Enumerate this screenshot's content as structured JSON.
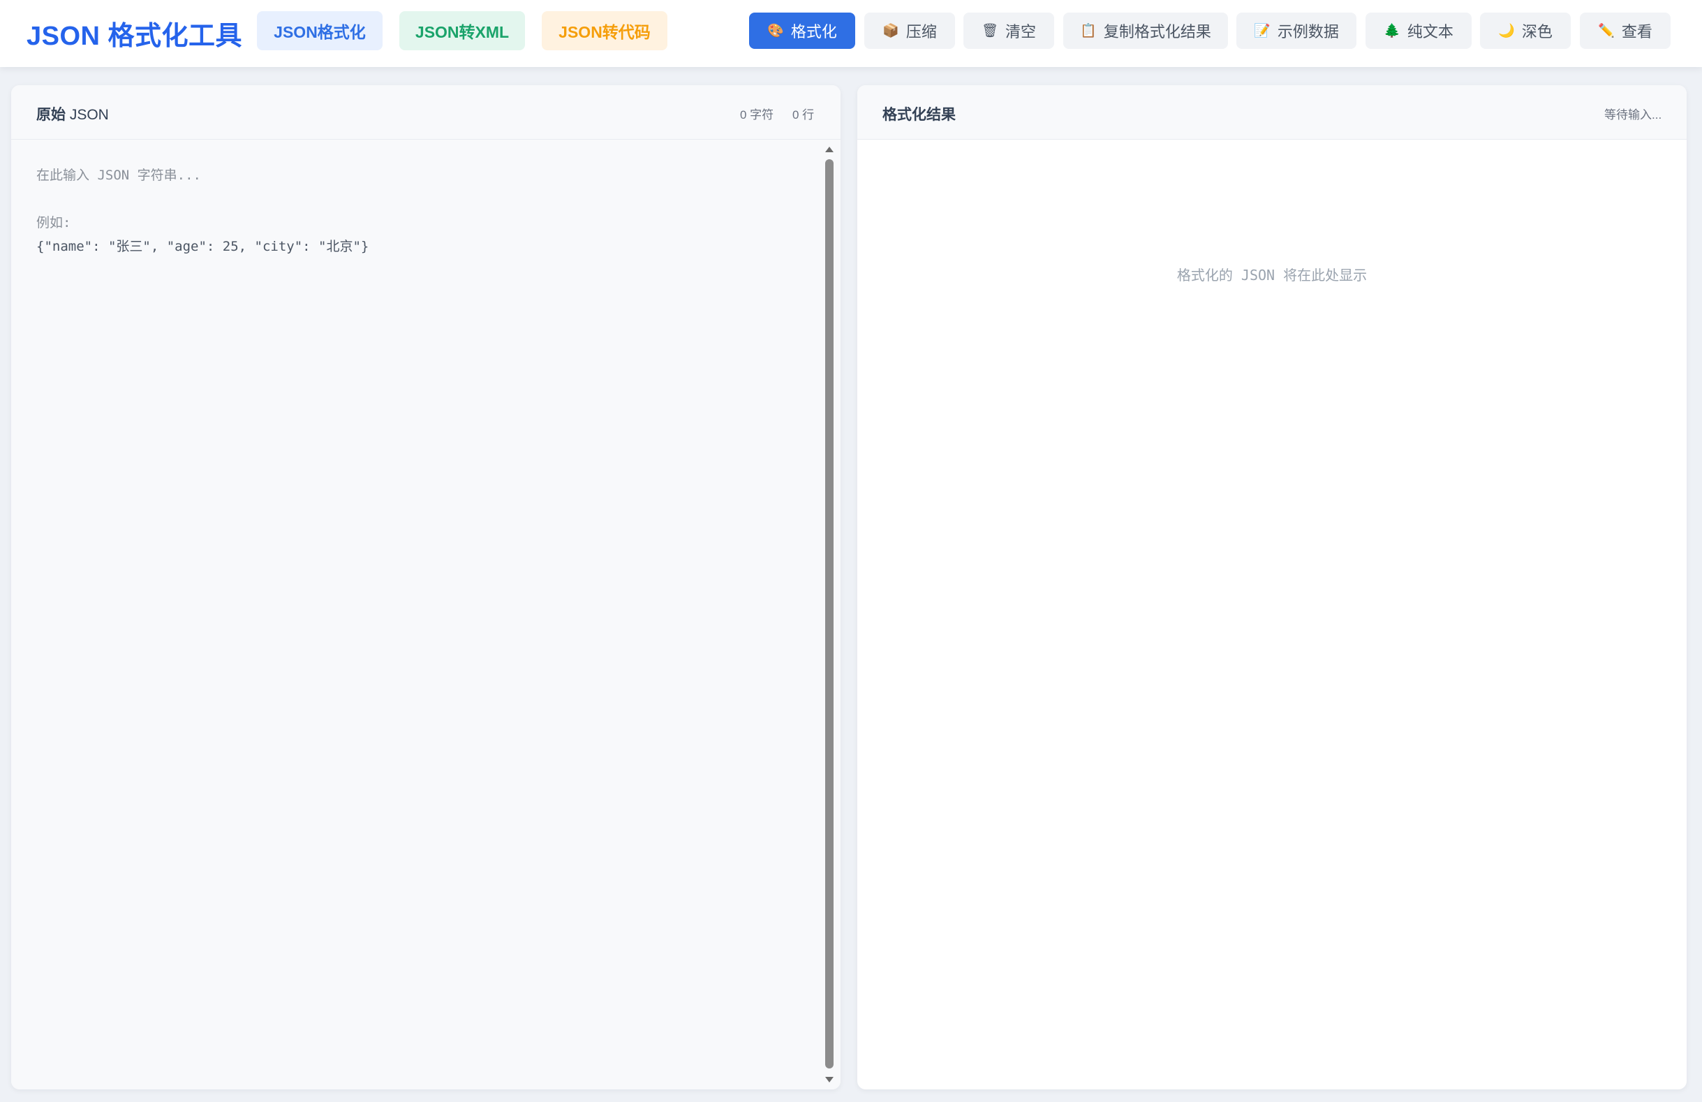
{
  "app": {
    "title": "JSON 格式化工具"
  },
  "modes": [
    {
      "label": "JSON格式化"
    },
    {
      "label": "JSON转XML"
    },
    {
      "label": "JSON转代码"
    }
  ],
  "toolbar": {
    "format": {
      "label": "格式化",
      "icon": "🎨"
    },
    "compress": {
      "label": "压缩",
      "icon": "📦"
    },
    "clear": {
      "label": "清空",
      "icon": "🗑"
    },
    "copy": {
      "label": "复制格式化结果",
      "icon": "📋"
    },
    "sample": {
      "label": "示例数据",
      "icon": "📝"
    },
    "plain": {
      "label": "纯文本",
      "icon": "🌲"
    },
    "theme": {
      "label": "深色",
      "icon": "🌙"
    },
    "view": {
      "label": "查看",
      "icon": "✏️"
    }
  },
  "input_panel": {
    "title_main": "原始",
    "title_sub": "JSON",
    "char_count": "0 字符",
    "line_count": "0 行",
    "placeholder_line1": "在此输入 JSON 字符串...",
    "placeholder_line2": "例如:",
    "placeholder_example": "{\"name\": \"张三\", \"age\": 25, \"city\": \"北京\"}"
  },
  "output_panel": {
    "title": "格式化结果",
    "status": "等待输入...",
    "empty_message": "格式化的 JSON 将在此处显示"
  },
  "colors": {
    "accent": "#2f6fe4",
    "brand_title": "#2563eb",
    "tab_green": "#1aa36a",
    "tab_orange": "#f59e0b"
  }
}
